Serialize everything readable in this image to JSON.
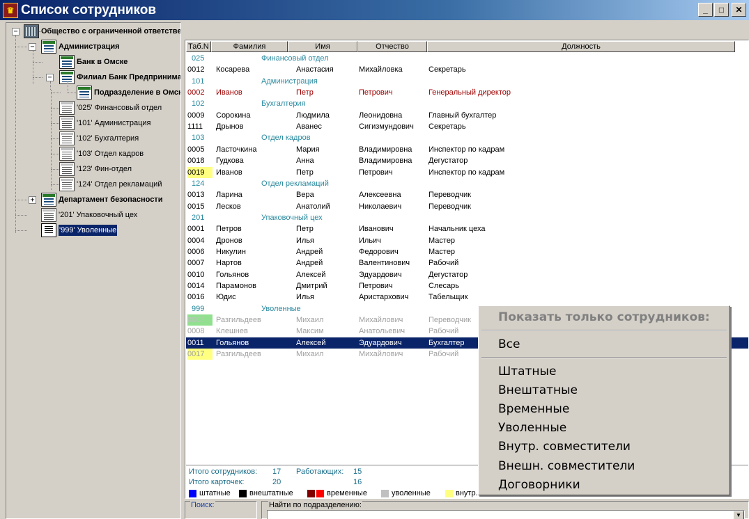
{
  "window": {
    "title": "Список сотрудников",
    "icon_name": "app-emblem-icon"
  },
  "tree": {
    "root": "Общество с ограниченной ответственностью",
    "items": [
      {
        "label": "Администрация",
        "bold": true
      },
      {
        "label": "Банк в Омске",
        "bold": true
      },
      {
        "label": "Филиал Банк Предпринимателей",
        "bold": true
      },
      {
        "label": "Подразделение в Омске",
        "bold": true
      },
      {
        "label": "'025' Финансовый отдел",
        "bold": false
      },
      {
        "label": "'101' Администрация",
        "bold": false
      },
      {
        "label": "'102' Бухгалтерия",
        "bold": false
      },
      {
        "label": "'103' Отдел кадров",
        "bold": false
      },
      {
        "label": "'123' Фин-отдел",
        "bold": false
      },
      {
        "label": "'124' Отдел рекламаций",
        "bold": false
      },
      {
        "label": "Департамент безопасности",
        "bold": true
      },
      {
        "label": "'201' Упаковочный цех",
        "bold": false
      },
      {
        "label": "'999' Уволенные",
        "bold": false
      }
    ]
  },
  "columns": [
    "Таб.N",
    "Фамилия",
    "Имя",
    "Отчество",
    "Должность"
  ],
  "rows": [
    {
      "type": "dept",
      "code": "025",
      "name": "Финансовый отдел"
    },
    {
      "type": "emp",
      "tab": "0012",
      "last": "Косарева",
      "first": "Анастасия",
      "middle": "Михайловка",
      "position": "Секретарь",
      "style": ""
    },
    {
      "type": "dept",
      "code": "101",
      "name": "Администрация"
    },
    {
      "type": "emp",
      "tab": "0002",
      "last": "Иванов",
      "first": "Петр",
      "middle": "Петрович",
      "position": "Генеральный директор",
      "style": "red"
    },
    {
      "type": "dept",
      "code": "102",
      "name": "Бухгалтерия"
    },
    {
      "type": "emp",
      "tab": "0009",
      "last": "Сорокина",
      "first": "Людмила",
      "middle": "Леонидовна",
      "position": "Главный бухгалтер",
      "style": ""
    },
    {
      "type": "emp",
      "tab": "1111",
      "last": "Дрынов",
      "first": "Аванес",
      "middle": "Сигизмундович",
      "position": "Секретарь",
      "style": ""
    },
    {
      "type": "dept",
      "code": "103",
      "name": "Отдел кадров"
    },
    {
      "type": "emp",
      "tab": "0005",
      "last": "Ласточкина",
      "first": "Мария",
      "middle": "Владимировна",
      "position": "Инспектор по кадрам",
      "style": ""
    },
    {
      "type": "emp",
      "tab": "0018",
      "last": "Гудкова",
      "first": "Анна",
      "middle": "Владимировна",
      "position": "Дегустатор",
      "style": ""
    },
    {
      "type": "emp",
      "tab": "0019",
      "last": "Иванов",
      "first": "Петр",
      "middle": "Петрович",
      "position": "Инспектор по кадрам",
      "style": "yellow"
    },
    {
      "type": "dept",
      "code": "124",
      "name": "Отдел рекламаций"
    },
    {
      "type": "emp",
      "tab": "0013",
      "last": "Ларина",
      "first": "Вера",
      "middle": "Алексеевна",
      "position": "Переводчик",
      "style": ""
    },
    {
      "type": "emp",
      "tab": "0015",
      "last": "Лесков",
      "first": "Анатолий",
      "middle": "Николаевич",
      "position": "Переводчик",
      "style": ""
    },
    {
      "type": "dept",
      "code": "201",
      "name": "Упаковочный цех"
    },
    {
      "type": "emp",
      "tab": "0001",
      "last": "Петров",
      "first": "Петр",
      "middle": "Иванович",
      "position": "Начальник цеха",
      "style": ""
    },
    {
      "type": "emp",
      "tab": "0004",
      "last": "Дронов",
      "first": "Илья",
      "middle": "Ильич",
      "position": "Мастер",
      "style": ""
    },
    {
      "type": "emp",
      "tab": "0006",
      "last": "Никулин",
      "first": "Андрей",
      "middle": "Федорович",
      "position": "Мастер",
      "style": ""
    },
    {
      "type": "emp",
      "tab": "0007",
      "last": "Нартов",
      "first": "Андрей",
      "middle": "Валентинович",
      "position": "Рабочий",
      "style": ""
    },
    {
      "type": "emp",
      "tab": "0010",
      "last": "Гольянов",
      "first": "Алексей",
      "middle": "Эдуардович",
      "position": "Дегустатор",
      "style": ""
    },
    {
      "type": "emp",
      "tab": "0014",
      "last": "Парамонов",
      "first": "Дмитрий",
      "middle": "Петрович",
      "position": "Слесарь",
      "style": ""
    },
    {
      "type": "emp",
      "tab": "0016",
      "last": "Юдис",
      "first": "Илья",
      "middle": "Аристархович",
      "position": "Табельщик",
      "style": ""
    },
    {
      "type": "dept",
      "code": "999",
      "name": "Уволенные"
    },
    {
      "type": "emp",
      "tab": "0003",
      "last": "Разгильдеев",
      "first": "Михаил",
      "middle": "Михайлович",
      "position": "Переводчик",
      "style": "dim-green"
    },
    {
      "type": "emp",
      "tab": "0008",
      "last": "Клешнев",
      "first": "Максим",
      "middle": "Анатольевич",
      "position": "Рабочий",
      "style": "dim"
    },
    {
      "type": "emp",
      "tab": "0011",
      "last": "Гольянов",
      "first": "Алексей",
      "middle": "Эдуардович",
      "position": "Бухгалтер",
      "style": "selected"
    },
    {
      "type": "emp",
      "tab": "0017",
      "last": "Разгильдеев",
      "first": "Михаил",
      "middle": "Михайлович",
      "position": "Рабочий",
      "style": "dim-yellow"
    }
  ],
  "summary": {
    "total_label": "Итого сотрудников:",
    "total_value": "17",
    "working_label": "Работающих:",
    "working_value": "15",
    "cards_label": "Итого карточек:",
    "cards_value": "20",
    "cards_working_value": "16"
  },
  "legend": [
    {
      "label": "штатные",
      "colors": [
        "#0000ff"
      ]
    },
    {
      "label": "внештатные",
      "colors": [
        "#000000"
      ]
    },
    {
      "label": "временные",
      "colors": [
        "#800000",
        "#ff0000"
      ]
    },
    {
      "label": "уволенные",
      "colors": [
        "#c0c0c0"
      ]
    },
    {
      "label": "внутр.",
      "colors": [
        "#ffff80"
      ]
    }
  ],
  "search": {
    "label": "Поиск:",
    "dept_label": "Найти по подразделению:",
    "dept_value": ""
  },
  "context_menu": {
    "title": "Показать только сотрудников:",
    "all": "Все",
    "items": [
      "Штатные",
      "Внештатные",
      "Временные",
      "Уволенные",
      "Внутр. совместители",
      "Внешн. совместители",
      "Договорники"
    ]
  }
}
